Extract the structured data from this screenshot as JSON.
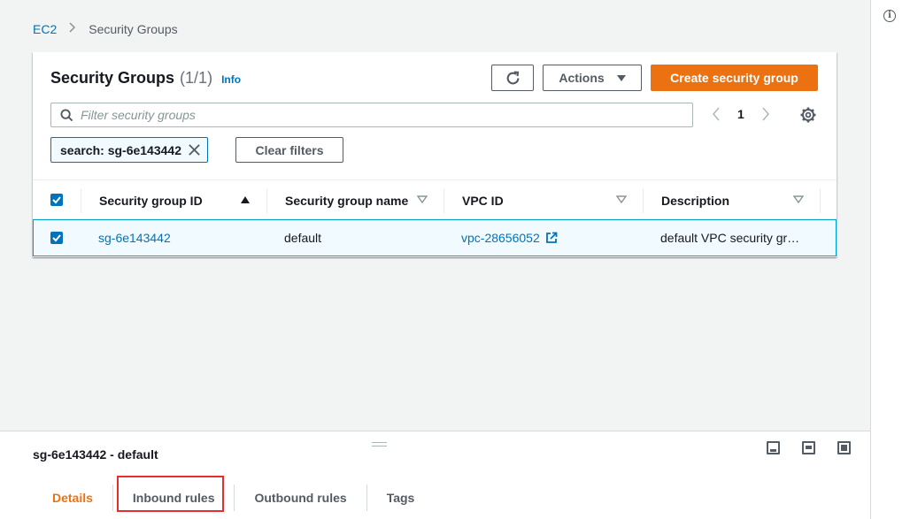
{
  "breadcrumb": {
    "root": "EC2",
    "current": "Security Groups"
  },
  "panel": {
    "title": "Security Groups",
    "count": "(1/1)",
    "info": "Info",
    "actions_label": "Actions",
    "create_label": "Create security group",
    "filter_placeholder": "Filter security groups",
    "page_number": "1",
    "token_label": "search: sg-6e143442",
    "clear_filters_label": "Clear filters"
  },
  "table": {
    "columns": [
      "Security group ID",
      "Security group name",
      "VPC ID",
      "Description"
    ],
    "rows": [
      {
        "id": "sg-6e143442",
        "name": "default",
        "vpc": "vpc-28656052",
        "description": "default VPC security gr…"
      }
    ]
  },
  "details": {
    "title": "sg-6e143442 - default",
    "tabs": [
      "Details",
      "Inbound rules",
      "Outbound rules",
      "Tags"
    ],
    "active_tab": "Details"
  },
  "colors": {
    "accent": "#ec7211",
    "link": "#0073bb",
    "highlight": "#e62e2e"
  },
  "icons": {
    "refresh": "refresh-icon",
    "search": "search-icon",
    "settings": "gear-icon",
    "external": "external-link-icon",
    "info": "info-icon"
  }
}
